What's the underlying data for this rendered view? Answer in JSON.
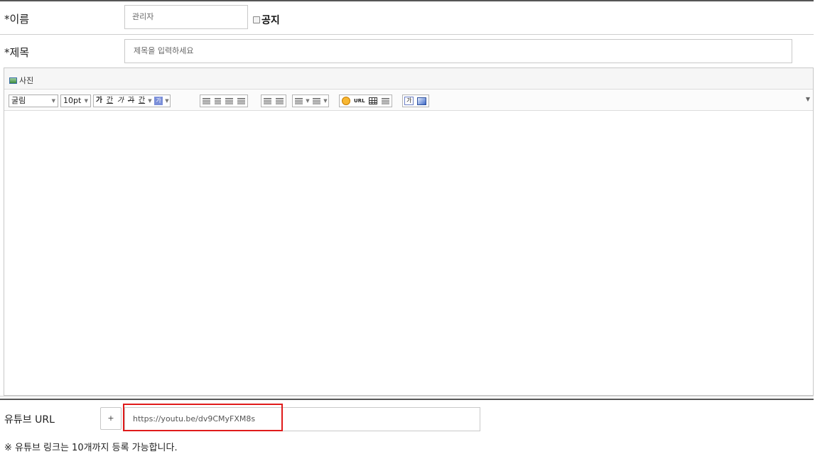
{
  "form": {
    "name_label": "*이름",
    "name_value": "관리자",
    "notice_label": "공지",
    "title_label": "*제목",
    "title_placeholder": "제목을 입력하세요"
  },
  "editor": {
    "photo_button": "사진",
    "font_name": "굴림",
    "font_size": "10pt",
    "toolbar": {
      "bold": "가",
      "underline": "간",
      "italic": "가",
      "strike": "가",
      "font_color": "간",
      "highlight": "가",
      "url": "URL",
      "html_mode": "가"
    }
  },
  "youtube": {
    "label": "유튜브 URL",
    "add_button": "+",
    "url_value": "https://youtu.be/dv9CMyFXM8s",
    "note": "※ 유튜브 링크는 10개까지 등록 가능합니다."
  },
  "colors": {
    "highlight_border": "#e01b1b",
    "toolbar_highlight": "#7b8fd9"
  }
}
